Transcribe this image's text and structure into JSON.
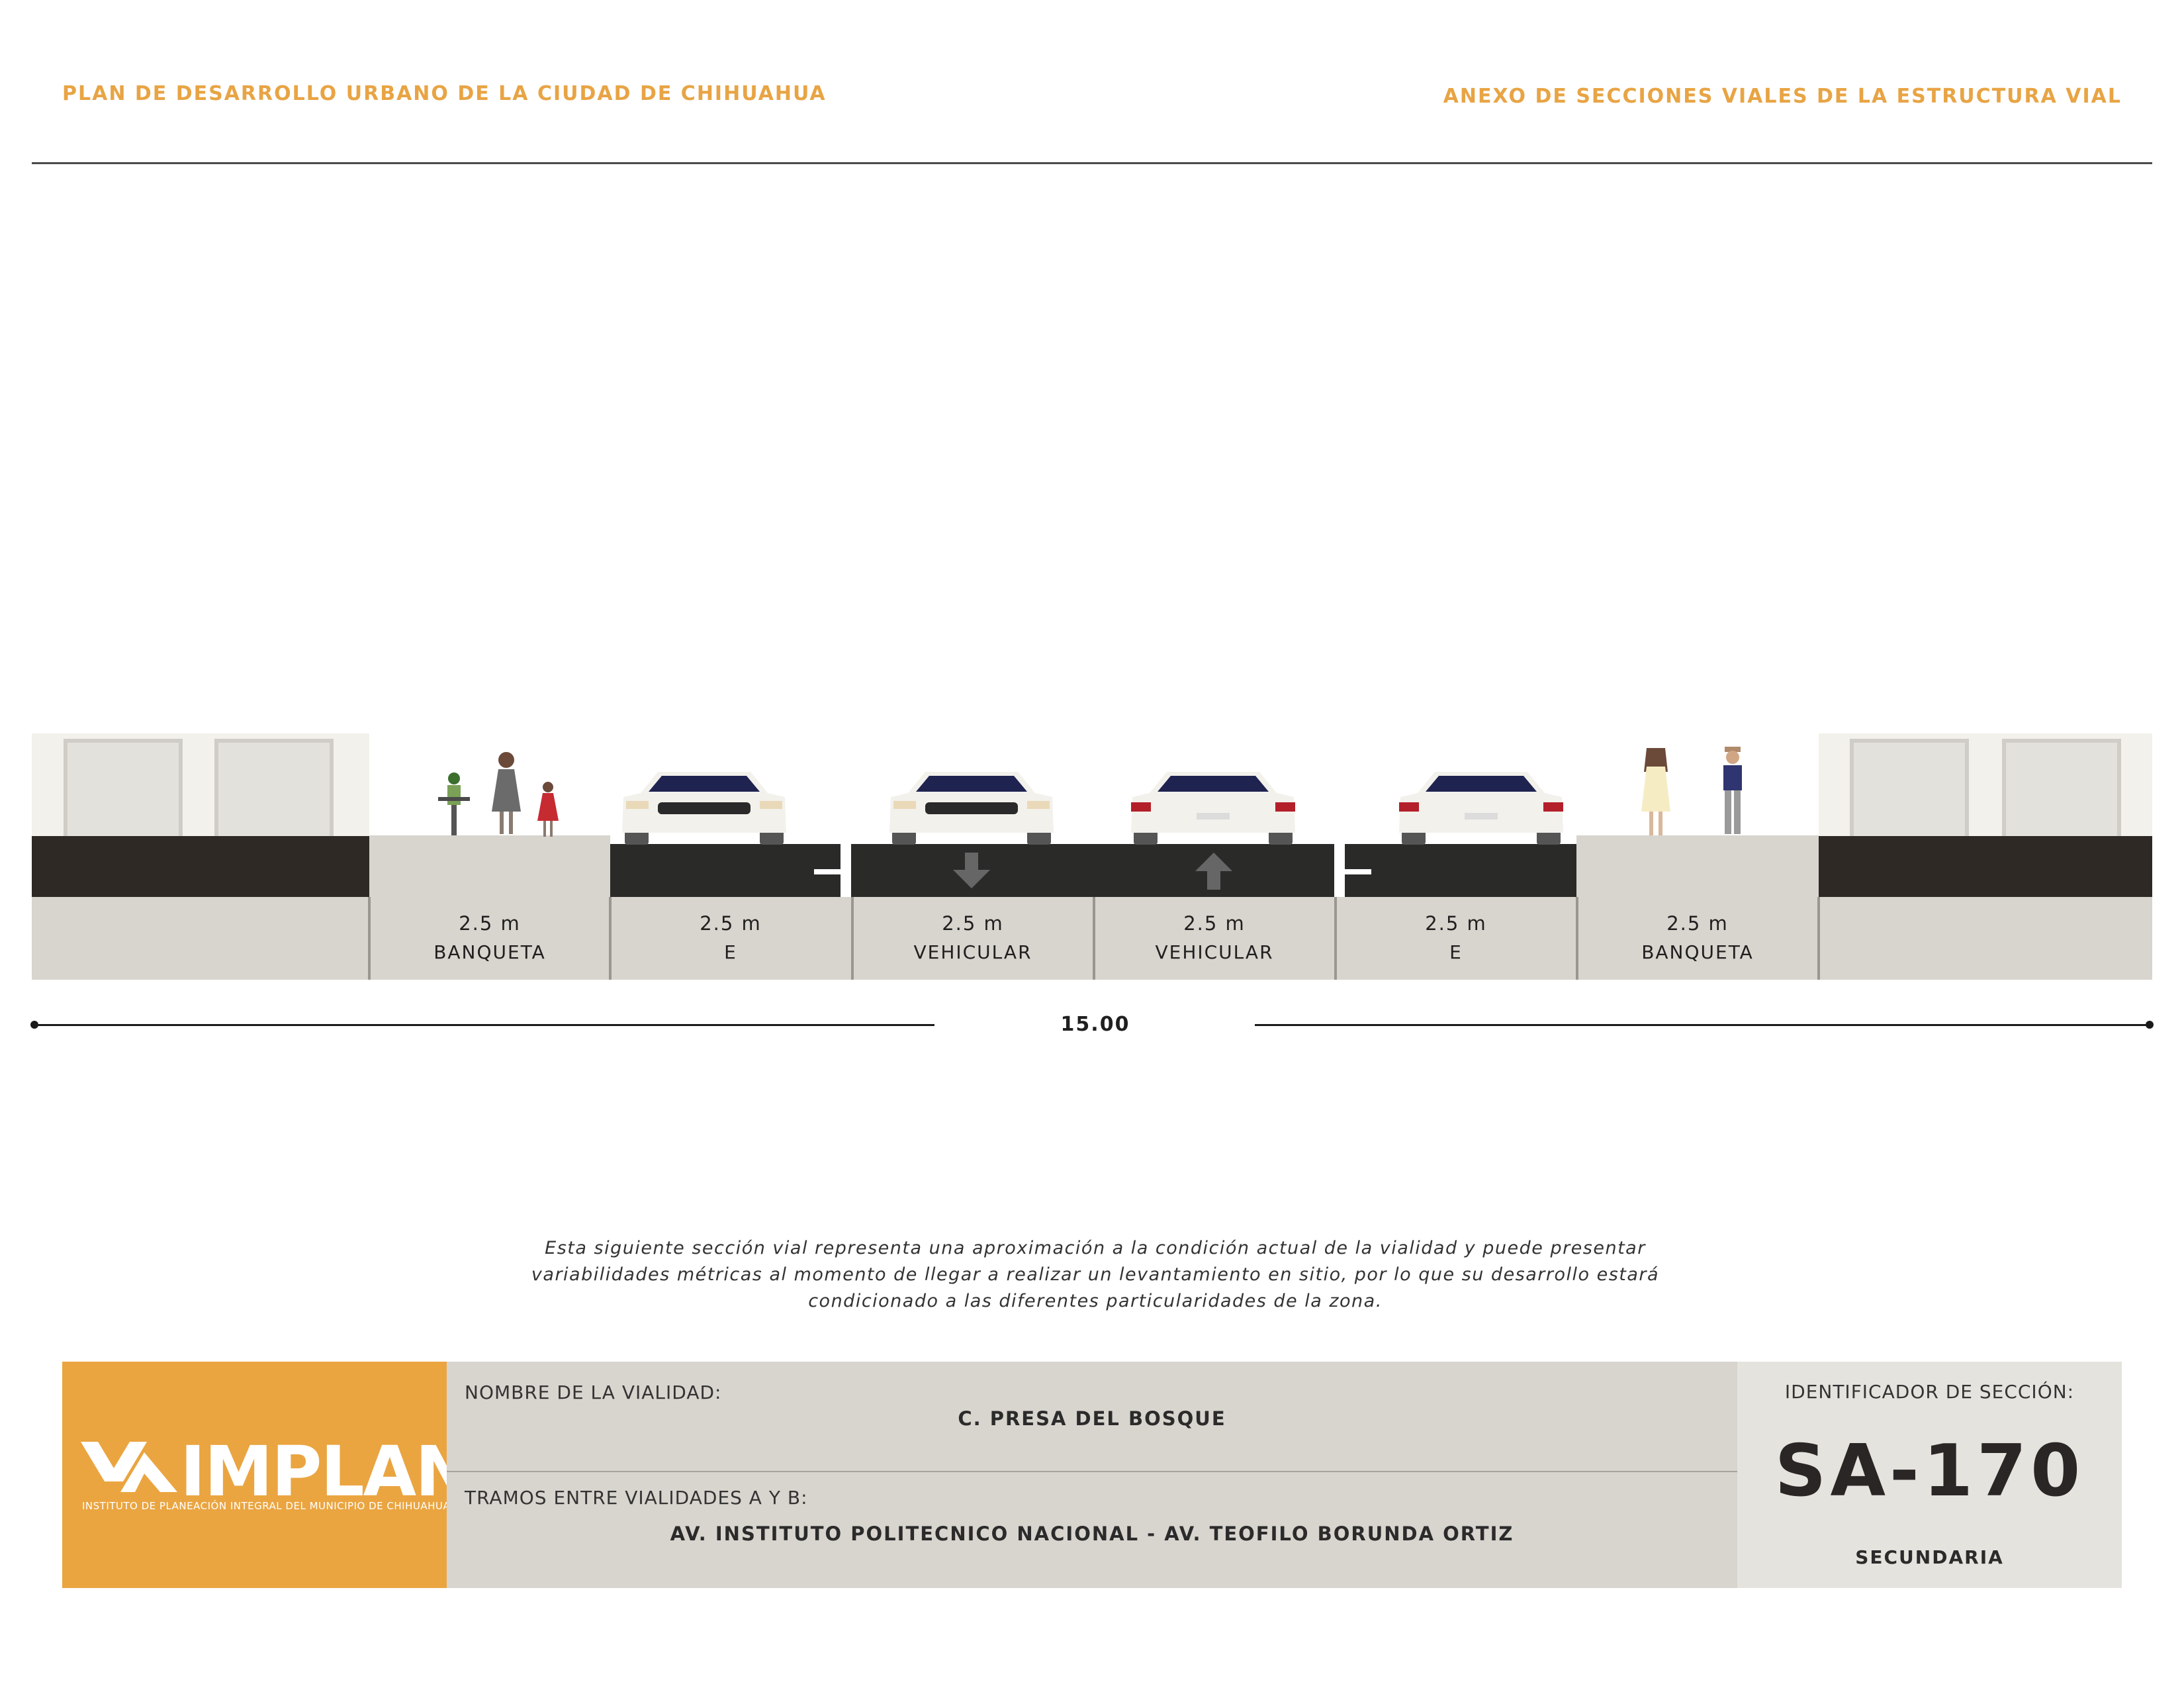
{
  "header": {
    "left": "PLAN DE DESARROLLO URBANO DE LA CIUDAD DE CHIHUAHUA",
    "right": "ANEXO DE SECCIONES VIALES DE LA ESTRUCTURA VIAL"
  },
  "section": {
    "lanes": [
      {
        "width": "2.5 m",
        "name": "BANQUETA"
      },
      {
        "width": "2.5 m",
        "name": "E"
      },
      {
        "width": "2.5 m",
        "name": "VEHICULAR"
      },
      {
        "width": "2.5 m",
        "name": "VEHICULAR"
      },
      {
        "width": "2.5 m",
        "name": "E"
      },
      {
        "width": "2.5 m",
        "name": "BANQUETA"
      }
    ],
    "total_width": "15.00",
    "direction_arrows": [
      "arrow-down",
      "arrow-up"
    ]
  },
  "note": "Esta siguiente sección vial representa una aproximación a la condición actual de la vialidad y puede presentar variabilidades métricas al momento de llegar a realizar un levantamiento en sitio, por lo que su desarrollo estará condicionado a las diferentes particularidades de la zona.",
  "footer": {
    "logo": {
      "word": "IMPLAN",
      "subtitle": "INSTITUTO DE PLANEACIÓN INTEGRAL DEL MUNICIPIO DE CHIHUAHUA"
    },
    "road_name_label": "NOMBRE DE LA VIALIDAD:",
    "road_name": "C. PRESA DEL BOSQUE",
    "segment_label": "TRAMOS ENTRE VIALIDADES A Y B:",
    "segment": "AV. INSTITUTO POLITECNICO NACIONAL - AV. TEOFILO BORUNDA ORTIZ",
    "id_label": "IDENTIFICADOR DE SECCIÓN:",
    "id_code": "SA-170",
    "classification": "SECUNDARIA"
  },
  "colors": {
    "accent": "#e8a444",
    "road": "#2a2b29",
    "ground": "#d8d4ce",
    "logo_bg": "#eaa541"
  }
}
